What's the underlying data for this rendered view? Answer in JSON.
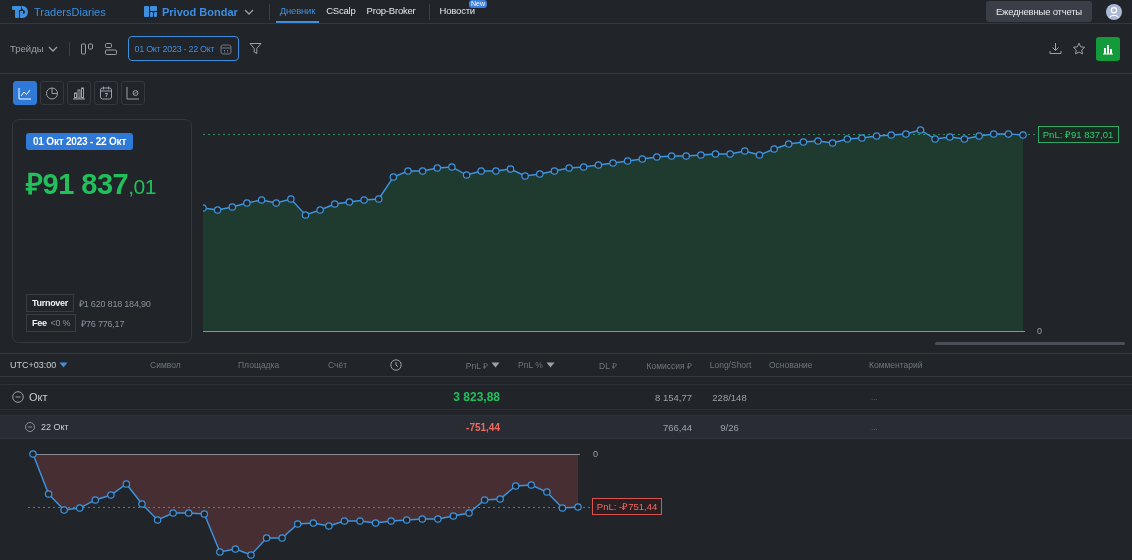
{
  "top_nav": {
    "logo": "TradersDiaries",
    "account": "Privod Bondar",
    "tabs": [
      {
        "label": "Дневник",
        "selected": true
      },
      {
        "label": "CScalp",
        "selected": false
      },
      {
        "label": "Prop-Broker",
        "selected": false
      },
      {
        "label": "Новости",
        "selected": false,
        "badge": "New"
      }
    ],
    "reports_button": "Ежедневные отчеты"
  },
  "toolbar": {
    "view_select": "Трейды",
    "date_range": "01 Окт 2023 - 22 Окт"
  },
  "chart_types": [
    {
      "kind": "line",
      "selected": true
    },
    {
      "kind": "pie",
      "selected": false
    },
    {
      "kind": "bar",
      "selected": false
    },
    {
      "kind": "calendar",
      "selected": false
    },
    {
      "kind": "scatter",
      "selected": false
    }
  ],
  "summary": {
    "period": "01 Окт 2023 - 22 Окт",
    "pnl": "₽91 837",
    "pnl_cents": ",01",
    "turnover_label": "Turnover",
    "turnover": "₽1 620 818 184,90",
    "fee_label": "Fee",
    "fee_share": "<0 %",
    "fee": "₽76 776,17"
  },
  "equity_chart": {
    "zero_label": "0",
    "pnl_label": "PnL: ₽91 837,01"
  },
  "table": {
    "columns": [
      {
        "label": "UTC+03:00",
        "kind": "tz"
      },
      {
        "label": "Символ",
        "kind": "text"
      },
      {
        "label": "Площадка",
        "kind": "text"
      },
      {
        "label": "Счёт",
        "kind": "text"
      },
      {
        "kind": "clock"
      },
      {
        "label": "PnL ₽",
        "kind": "sort"
      },
      {
        "label": "PnL %",
        "kind": "sort"
      },
      {
        "label": "DL ₽",
        "kind": "text"
      },
      {
        "label": "Комиссия ₽",
        "kind": "text"
      },
      {
        "label": "Long/Short",
        "kind": "text"
      },
      {
        "label": "Основание",
        "kind": "text"
      },
      {
        "label": "Комментарий",
        "kind": "text"
      }
    ],
    "rows": [
      {
        "kind": "month",
        "expanded": true,
        "label": "Окт",
        "pnl": "3 823,88",
        "positive": true,
        "commission": "8 154,77",
        "long_short": "228/148",
        "comment": "..."
      },
      {
        "kind": "day",
        "expanded": true,
        "label": "22 Окт",
        "pnl": "-751,44",
        "positive": false,
        "commission": "766,44",
        "long_short": "9/26",
        "comment": "..."
      }
    ]
  },
  "day_chart": {
    "zero_label": "0",
    "pnl_label": "PnL: -₽751,44"
  }
}
